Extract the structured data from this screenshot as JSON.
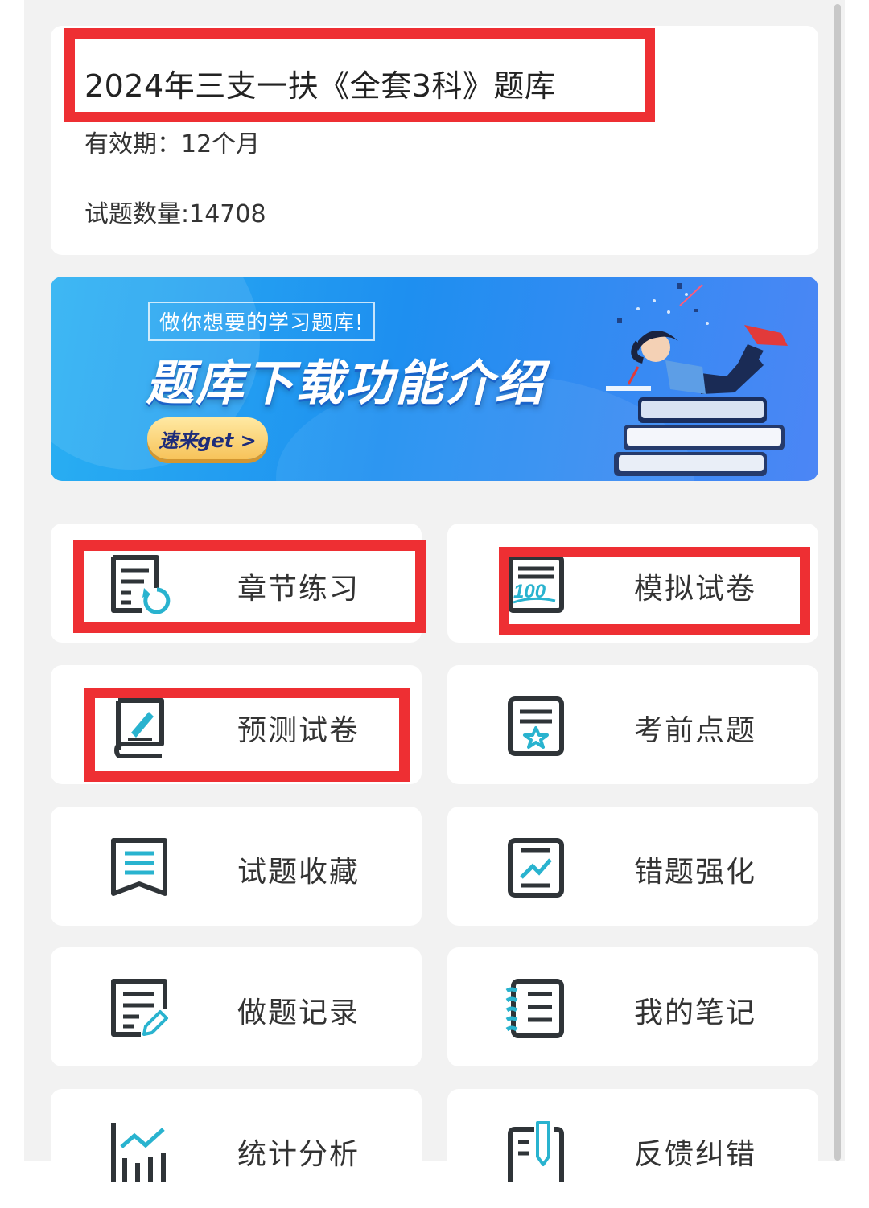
{
  "header": {
    "title": "2024年三支一扶《全套3科》题库",
    "validity": "有效期：12个月",
    "question_count": "试题数量:14708"
  },
  "banner": {
    "tag": "做你想要的学习题库!",
    "headline": "题库下载功能介绍",
    "button": "速来get >"
  },
  "menu": [
    {
      "label": "章节练习",
      "icon": "chapter-practice-icon"
    },
    {
      "label": "模拟试卷",
      "icon": "mock-exam-icon"
    },
    {
      "label": "预测试卷",
      "icon": "prediction-exam-icon"
    },
    {
      "label": "考前点题",
      "icon": "pre-exam-tips-icon"
    },
    {
      "label": "试题收藏",
      "icon": "bookmark-icon"
    },
    {
      "label": "错题强化",
      "icon": "wrong-answers-icon"
    },
    {
      "label": "做题记录",
      "icon": "history-icon"
    },
    {
      "label": "我的笔记",
      "icon": "notebook-icon"
    },
    {
      "label": "统计分析",
      "icon": "statistics-icon"
    },
    {
      "label": "反馈纠错",
      "icon": "feedback-icon"
    }
  ],
  "colors": {
    "annotation_red": "#ee2f33",
    "icon_dark": "#2f3438",
    "icon_accent": "#29b3cf",
    "banner_blue": "#1e8ff0"
  }
}
